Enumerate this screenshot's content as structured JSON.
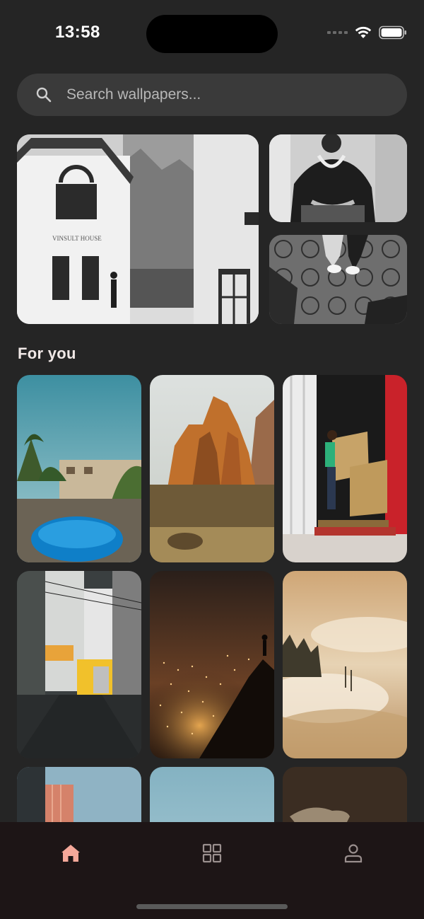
{
  "status": {
    "time": "13:58"
  },
  "search": {
    "placeholder": "Search wallpapers..."
  },
  "featured": [
    {
      "icon": "building-photo",
      "label": "VINSULT HOUSE"
    },
    {
      "icon": "portrait-photo"
    },
    {
      "icon": "tiled-floor-photo"
    }
  ],
  "for_you": {
    "title": "For you"
  },
  "tiles": [
    "palm-pool-photo",
    "red-rock-photo",
    "container-hay-photo",
    "street-photo",
    "city-lights-photo",
    "fog-forest-photo",
    "tower-photo",
    "sky-photo",
    "fox-photo"
  ],
  "nav": {
    "items": [
      {
        "icon": "home-icon",
        "active": true
      },
      {
        "icon": "grid-icon",
        "active": false
      },
      {
        "icon": "person-icon",
        "active": false
      }
    ],
    "colors": {
      "active": "#f5a89a",
      "inactive": "#9a8f8e",
      "background": "#1d1516"
    }
  }
}
